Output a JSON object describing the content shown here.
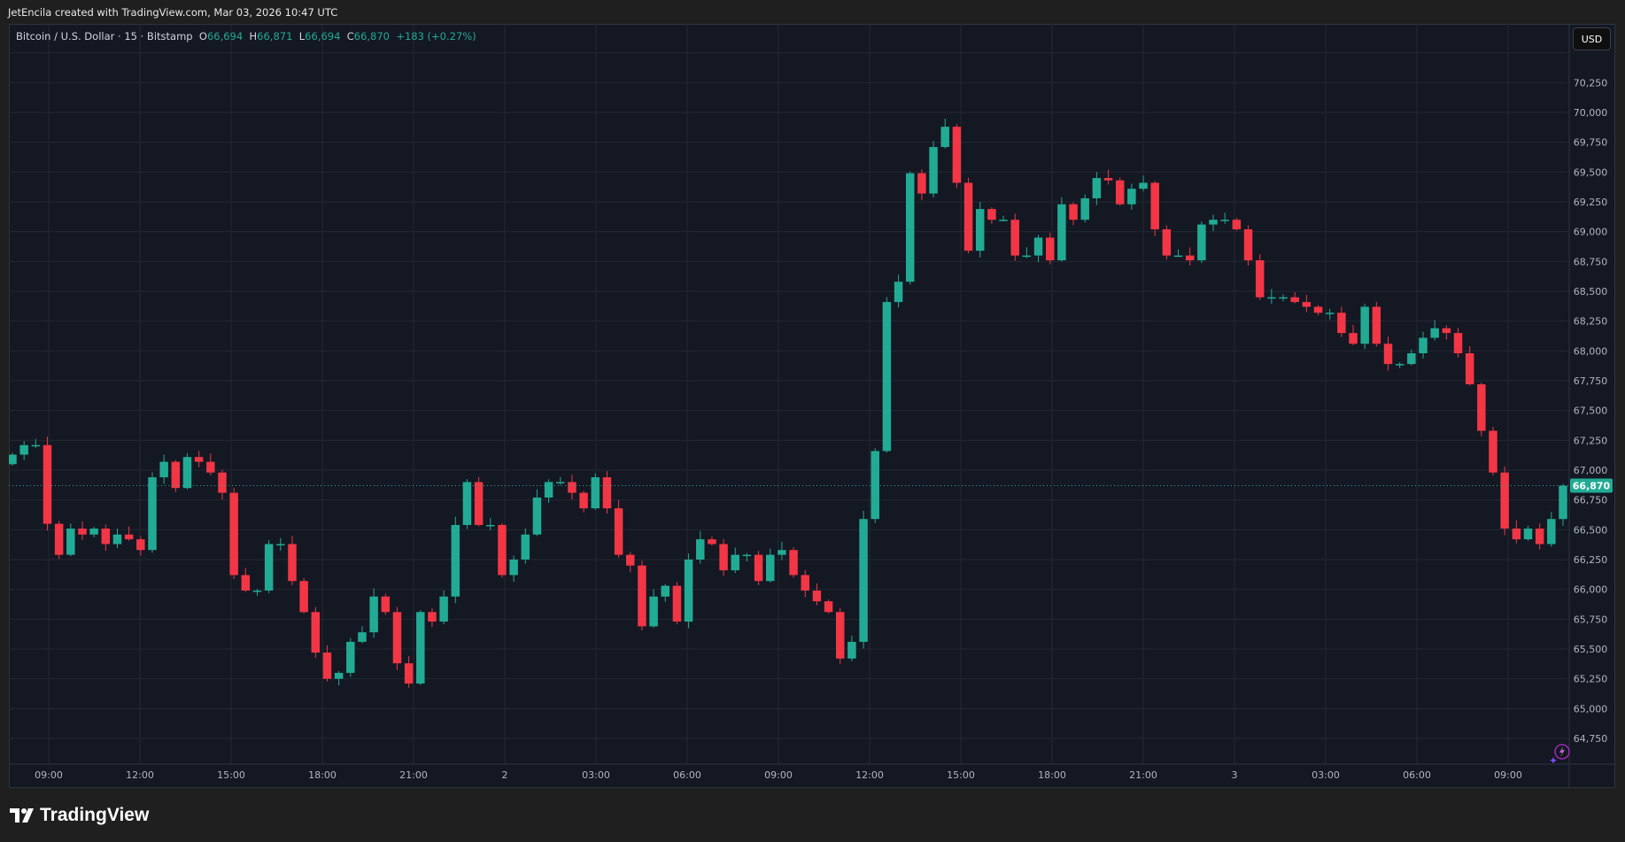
{
  "credit": "JetEncila created with TradingView.com, Mar 03, 2026 10:47 UTC",
  "legend": {
    "symbol": "Bitcoin / U.S. Dollar · 15 · Bitstamp",
    "o_label": "O",
    "o": "66,694",
    "h_label": "H",
    "h": "66,871",
    "l_label": "L",
    "l": "66,694",
    "c_label": "C",
    "c": "66,870",
    "change": "+183 (+0.27%)"
  },
  "currency_button": "USD",
  "logo_text": "TradingView",
  "colors": {
    "up": "#22ab94",
    "down": "#f23645",
    "background": "#141823",
    "grid": "#232733"
  },
  "chart_data": {
    "type": "candlestick",
    "title": "Bitcoin / U.S. Dollar · 15 · Bitstamp",
    "ylim": [
      64600,
      70600
    ],
    "y_ticks": [
      64750,
      65000,
      65250,
      65500,
      65750,
      66000,
      66250,
      66500,
      66750,
      67000,
      67250,
      67500,
      67750,
      68000,
      68250,
      68500,
      68750,
      69000,
      69250,
      69500,
      69750,
      70000,
      70250
    ],
    "x_ticks": [
      "09:00",
      "12:00",
      "15:00",
      "18:00",
      "21:00",
      "2",
      "03:00",
      "06:00",
      "09:00",
      "12:00",
      "15:00",
      "18:00",
      "21:00",
      "3",
      "03:00",
      "06:00",
      "09:00"
    ],
    "first_open": 67050,
    "closes": [
      67130,
      67210,
      67210,
      66550,
      66290,
      66510,
      66460,
      66510,
      66380,
      66460,
      66420,
      66330,
      66940,
      67070,
      66850,
      67110,
      67070,
      66980,
      66810,
      66120,
      65990,
      65990,
      66380,
      66380,
      66070,
      65810,
      65470,
      65250,
      65300,
      65560,
      65640,
      65940,
      65810,
      65380,
      65210,
      65810,
      65730,
      65940,
      66540,
      66900,
      66540,
      66540,
      66120,
      66250,
      66460,
      66770,
      66900,
      66900,
      66810,
      66680,
      66940,
      66680,
      66290,
      66200,
      65690,
      65940,
      66030,
      65730,
      66250,
      66420,
      66380,
      66160,
      66290,
      66290,
      66070,
      66290,
      66330,
      66120,
      65990,
      65900,
      65810,
      65420,
      65560,
      66590,
      67160,
      68410,
      68580,
      69490,
      69320,
      69710,
      69880,
      69410,
      68840,
      69190,
      69100,
      69100,
      68800,
      68800,
      68950,
      68760,
      69230,
      69100,
      69280,
      69450,
      69430,
      69230,
      69360,
      69410,
      69020,
      68800,
      68800,
      68760,
      69060,
      69100,
      69100,
      69020,
      68760,
      68450,
      68450,
      68450,
      68410,
      68370,
      68320,
      68320,
      68150,
      68060,
      68370,
      68060,
      67890,
      67890,
      67980,
      68110,
      68190,
      68150,
      67980,
      67720,
      67330,
      66980,
      66510,
      66420,
      66510,
      66380,
      66590,
      66870
    ],
    "last_price": 66870,
    "last_price_label": "66,870"
  }
}
